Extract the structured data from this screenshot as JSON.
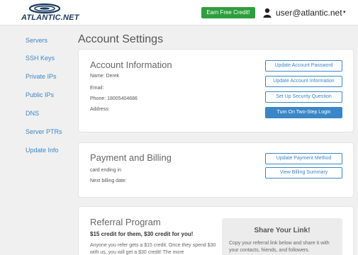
{
  "header": {
    "logo_text": "ATLANTIC.NET",
    "earn_button": "Earn Free Credit!",
    "user_email": "user@atlantic.net",
    "caret": "▾"
  },
  "sidebar": {
    "items": [
      {
        "label": "Servers"
      },
      {
        "label": "SSH Keys"
      },
      {
        "label": "Private IPs"
      },
      {
        "label": "Public IPs"
      },
      {
        "label": "DNS"
      },
      {
        "label": "Server PTRs"
      },
      {
        "label": "Update Info"
      }
    ]
  },
  "page": {
    "title": "Account Settings"
  },
  "account": {
    "title": "Account Information",
    "name": "Name: Derek",
    "email": "Email:",
    "phone": "Phone: 18005404686",
    "address": "Address:",
    "buttons": {
      "update_password": "Update Account Password",
      "update_info": "Update Account Information",
      "security_question": "Set Up Security Question",
      "two_step": "Turn On Two-Step Login"
    }
  },
  "billing": {
    "title": "Payment and Billing",
    "card": "card ending in",
    "next_date": "Next billing date:",
    "buttons": {
      "update_method": "Update Payment Method",
      "view_summary": "View Billing Summary"
    }
  },
  "referral": {
    "title": "Referral Program",
    "subtitle": "$15 credit for them, $30 credit for you!",
    "text": "Anyone you refer gets a $15 credit. Once they spend $30 with us, you will get a $30 credit! The more",
    "share_title": "Share Your Link!",
    "share_text": "Copy your referral link below and share it with your contacts, friends, and followers."
  },
  "colors": {
    "accent": "#3b86c6",
    "earn_green": "#2e9e3e",
    "background": "#f0f0f0"
  }
}
